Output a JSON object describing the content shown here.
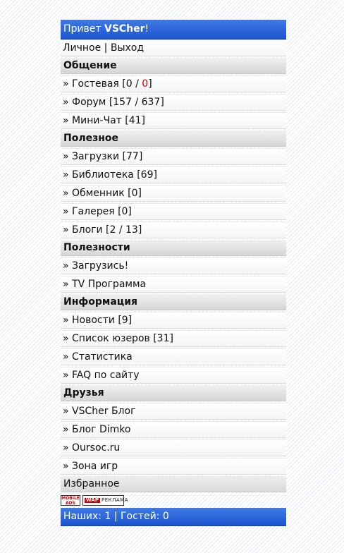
{
  "header": {
    "greeting": "Привет ",
    "username": "VSCher",
    "suffix": "!"
  },
  "account": {
    "personal": "Личное",
    "separator": " | ",
    "logout": "Выход"
  },
  "sections": {
    "communication": {
      "title": "Общение",
      "guestbook": {
        "label": "» Гостевая [0 / ",
        "new": "0",
        "close": "]"
      },
      "forum": "» Форум [157 / 637]",
      "minichat": "» Мини-Чат [41]"
    },
    "useful": {
      "title": "Полезное",
      "items": [
        "» Загрузки [77]",
        "» Библиотека [69]",
        "» Обменник [0]",
        "» Галерея [0]",
        "» Блоги [2 / 13]"
      ]
    },
    "usefuls": {
      "title": "Полезности",
      "items": [
        "» Загрузись!",
        "» TV Программа"
      ]
    },
    "info": {
      "title": "Информация",
      "items": [
        "» Новости [9]",
        "» Список юзеров [31]",
        "» Статистика",
        "» FAQ по сайту"
      ]
    },
    "friends": {
      "title": "Друзья",
      "items": [
        "» VSCher Блог",
        "» Блог Dimko",
        "» Oursoc.ru",
        "» Зона игр"
      ]
    }
  },
  "favorites": "Избранное",
  "banners": {
    "mobile_ads": {
      "line1": "MOBILE",
      "line2": "ADS"
    },
    "wap_ads": {
      "wap": "WAP",
      "rest": "РЕКЛАМА"
    }
  },
  "footer": {
    "ours_label": "Наших: ",
    "ours": "1",
    "guests_label": " | Гостей: ",
    "guests": "0"
  }
}
